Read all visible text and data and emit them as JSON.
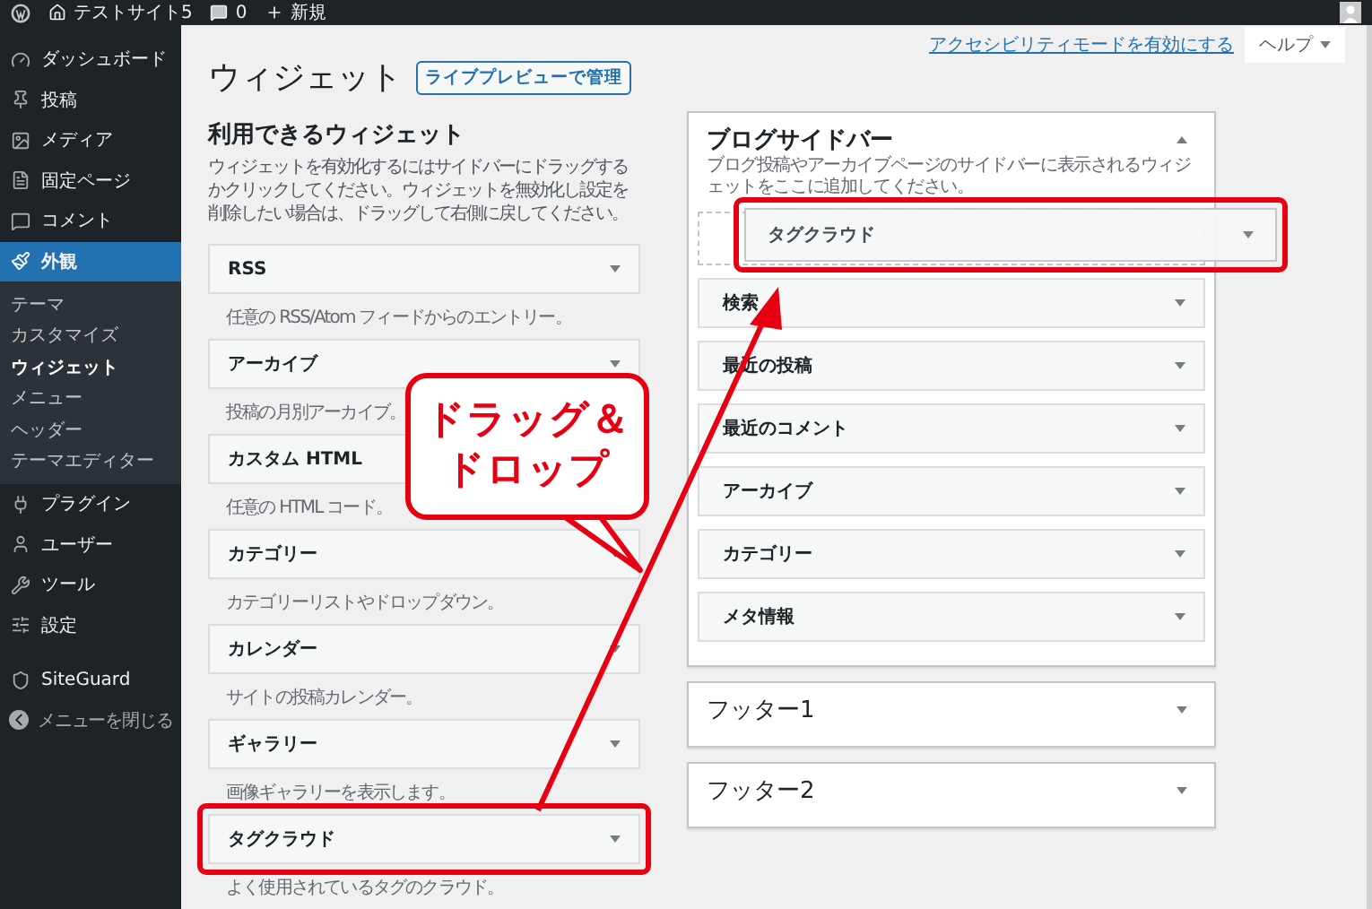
{
  "admin_bar": {
    "site": "テストサイト5",
    "comments": "0",
    "new": "新規"
  },
  "menu": [
    {
      "label": "ダッシュボード",
      "selected": false
    },
    {
      "label": "投稿",
      "selected": false
    },
    {
      "label": "メディア",
      "selected": false
    },
    {
      "label": "固定ページ",
      "selected": false
    },
    {
      "label": "コメント",
      "selected": false
    },
    {
      "label": "外観",
      "selected": true,
      "children": [
        {
          "label": "テーマ",
          "selected": false
        },
        {
          "label": "カスタマイズ",
          "selected": false
        },
        {
          "label": "ウィジェット",
          "selected": true
        },
        {
          "label": "メニュー",
          "selected": false
        },
        {
          "label": "ヘッダー",
          "selected": false
        },
        {
          "label": "テーマエディター",
          "selected": false
        }
      ]
    },
    {
      "label": "プラグイン",
      "selected": false
    },
    {
      "label": "ユーザー",
      "selected": false
    },
    {
      "label": "ツール",
      "selected": false
    },
    {
      "label": "設定",
      "selected": false
    },
    {
      "label": "SiteGuard",
      "selected": false
    }
  ],
  "close_menu": "メニューを閉じる",
  "accessibility_link": "アクセシビリティモードを有効にする",
  "help_button": "ヘルプ",
  "page_title": "ウィジェット",
  "preview_button": "ライブプレビューで管理",
  "available": {
    "title": "利用できるウィジェット",
    "description": "ウィジェットを有効化するにはサイドバーにドラッグするかクリックしてください。ウィジェットを無効化し設定を削除したい場合は、ドラッグして右側に戻してください。",
    "widgets": [
      {
        "name": "RSS",
        "description": "任意の RSS/Atom フィードからのエントリー。",
        "highlighted": false
      },
      {
        "name": "アーカイブ",
        "description": "投稿の月別アーカイブ。",
        "highlighted": false
      },
      {
        "name": "カスタム HTML",
        "description": "任意の HTML コード。",
        "highlighted": false
      },
      {
        "name": "カテゴリー",
        "description": "カテゴリーリストやドロップダウン。",
        "highlighted": false
      },
      {
        "name": "カレンダー",
        "description": "サイトの投稿カレンダー。",
        "highlighted": false
      },
      {
        "name": "ギャラリー",
        "description": "画像ギャラリーを表示します。",
        "highlighted": false
      },
      {
        "name": "タグクラウド",
        "description": "よく使用されているタグのクラウド。",
        "highlighted": true
      }
    ]
  },
  "sidebars": [
    {
      "title": "ブログサイドバー",
      "expanded": true,
      "description": "ブログ投稿やアーカイブページのサイドバーに表示されるウィジェットをここに追加してください。",
      "widgets": [
        "検索",
        "最近の投稿",
        "最近のコメント",
        "アーカイブ",
        "カテゴリー",
        "メタ情報"
      ]
    },
    {
      "title": "フッター1",
      "expanded": false
    },
    {
      "title": "フッター2",
      "expanded": false
    }
  ],
  "dragged_widget": {
    "name": "タグクラウド",
    "highlighted": true
  },
  "callout": {
    "lines": [
      "ドラッグ＆",
      "ドロップ"
    ]
  }
}
